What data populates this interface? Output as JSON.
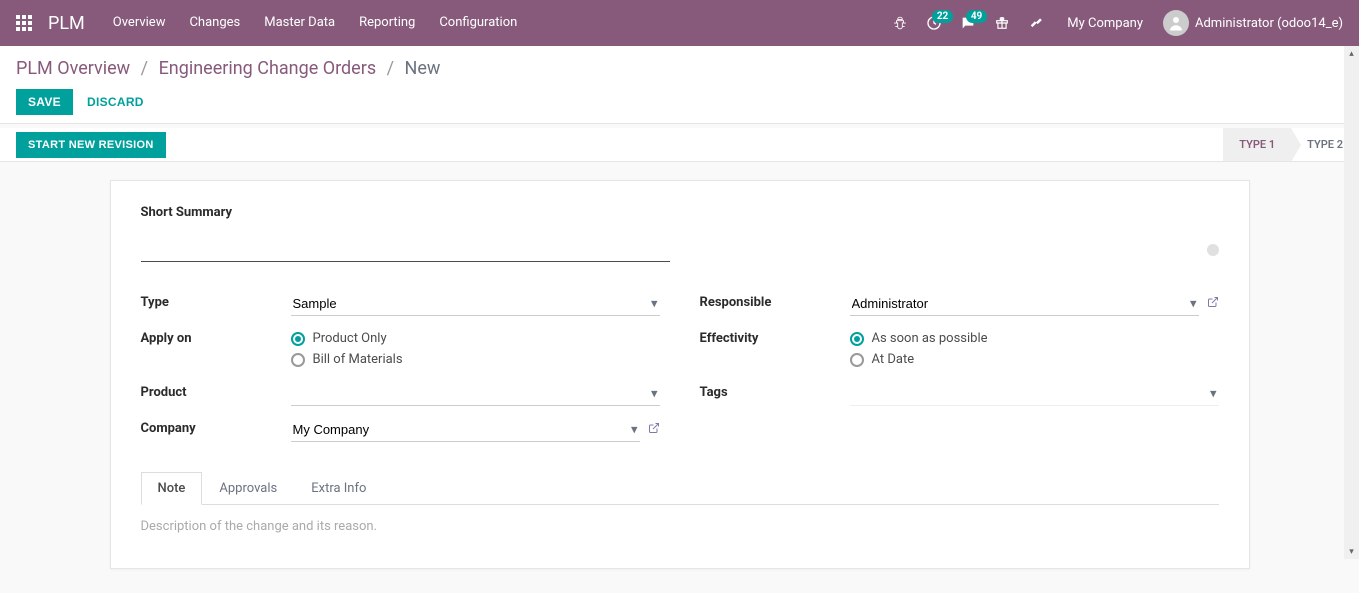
{
  "navbar": {
    "brand": "PLM",
    "menu": [
      "Overview",
      "Changes",
      "Master Data",
      "Reporting",
      "Configuration"
    ],
    "badges": {
      "activities": "22",
      "discuss": "49"
    },
    "company": "My Company",
    "user": "Administrator (odoo14_e)"
  },
  "breadcrumb": {
    "items": [
      "PLM Overview",
      "Engineering Change Orders"
    ],
    "current": "New"
  },
  "actions": {
    "save": "SAVE",
    "discard": "DISCARD"
  },
  "statusbar": {
    "button": "START NEW REVISION",
    "stages": [
      {
        "label": "TYPE 1",
        "active": true
      },
      {
        "label": "TYPE 2",
        "active": false
      }
    ]
  },
  "form": {
    "summary_label": "Short Summary",
    "summary_value": "",
    "left": {
      "type": {
        "label": "Type",
        "value": "Sample"
      },
      "apply_on": {
        "label": "Apply on",
        "options": [
          {
            "label": "Product Only",
            "checked": true
          },
          {
            "label": "Bill of Materials",
            "checked": false
          }
        ]
      },
      "product": {
        "label": "Product",
        "value": ""
      },
      "company": {
        "label": "Company",
        "value": "My Company"
      }
    },
    "right": {
      "responsible": {
        "label": "Responsible",
        "value": "Administrator"
      },
      "effectivity": {
        "label": "Effectivity",
        "options": [
          {
            "label": "As soon as possible",
            "checked": true
          },
          {
            "label": "At Date",
            "checked": false
          }
        ]
      },
      "tags": {
        "label": "Tags",
        "value": ""
      }
    }
  },
  "tabs": {
    "items": [
      "Note",
      "Approvals",
      "Extra Info"
    ],
    "active": 0,
    "note_placeholder": "Description of the change and its reason."
  }
}
